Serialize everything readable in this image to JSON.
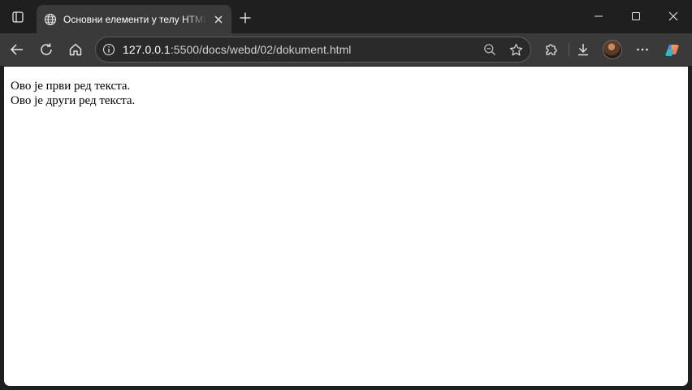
{
  "tab": {
    "title": "Основни елементи у телу HTML",
    "favicon_icon": "globe-icon"
  },
  "address": {
    "url_host": "127.0.0.1",
    "url_rest": ":5500/docs/webd/02/dokument.html"
  },
  "page": {
    "lines": [
      "Ово је први ред текста.",
      "Ово је други ред текста."
    ]
  },
  "colors": {
    "chrome_dark": "#1f1f1f",
    "toolbar": "#3a3a3a",
    "page_bg": "#ffffff",
    "text": "#000000"
  }
}
